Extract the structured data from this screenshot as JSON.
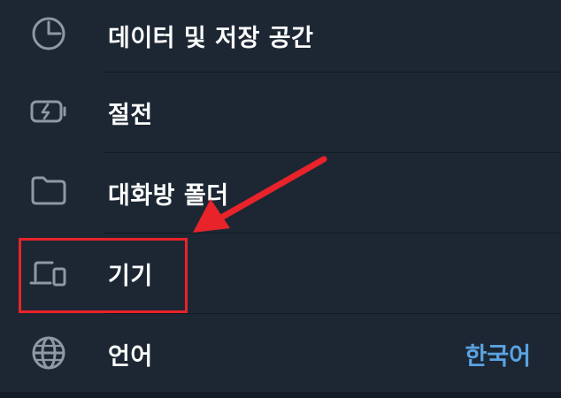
{
  "settings": {
    "items": [
      {
        "label": "데이터 및 저장 공간",
        "icon": "pie-chart-icon"
      },
      {
        "label": "절전",
        "icon": "battery-charging-icon"
      },
      {
        "label": "대화방 폴더",
        "icon": "folder-icon"
      },
      {
        "label": "기기",
        "icon": "devices-icon"
      },
      {
        "label": "언어",
        "icon": "globe-icon",
        "value": "한국어"
      }
    ]
  },
  "colors": {
    "background": "#1d2733",
    "text": "#ffffff",
    "accent": "#5aa3e2",
    "icon": "#8e99a5",
    "annotation": "#e8232a"
  }
}
